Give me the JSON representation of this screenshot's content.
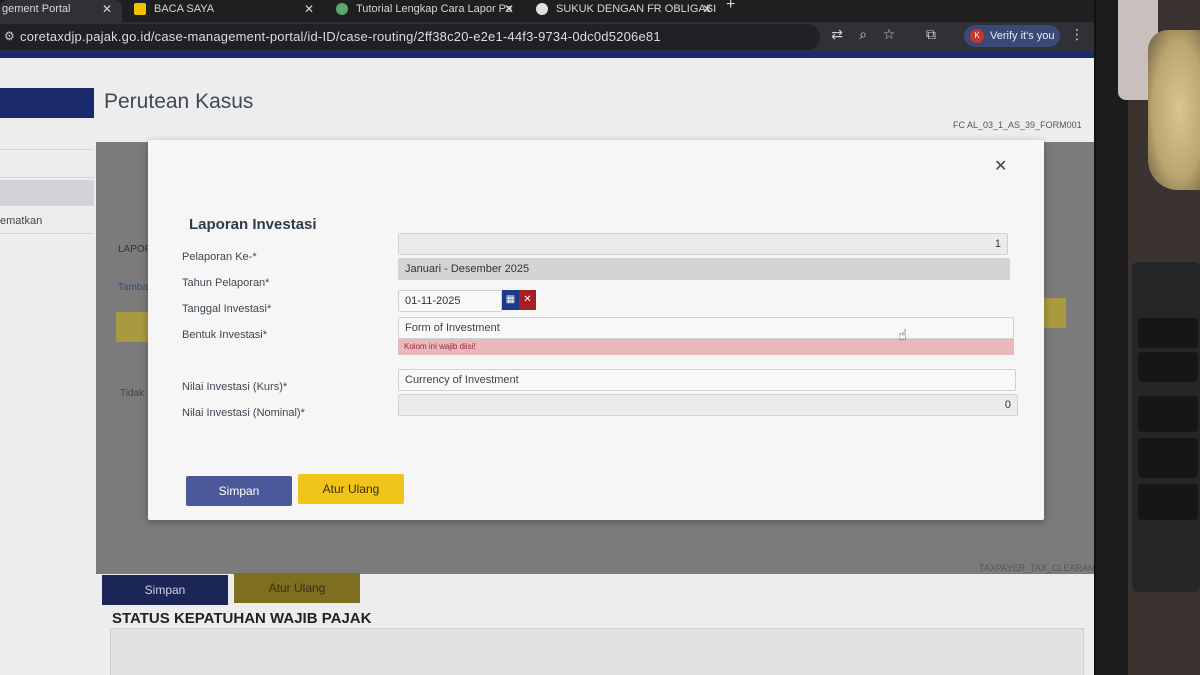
{
  "browser": {
    "tabs": [
      {
        "label": "gement Portal",
        "active": true
      },
      {
        "label": "BACA SAYA",
        "active": false
      },
      {
        "label": "Tutorial Lengkap Cara Lapor Pa",
        "active": false
      },
      {
        "label": "SUKUK DENGAN FR OBLIGASI",
        "active": false
      }
    ],
    "url": "coretaxdjp.pajak.go.id/case-management-portal/id-ID/case-routing/2ff38c20-e2e1-44f3-9734-0dc0d5206e81",
    "profile_initial": "K",
    "verify_label": "Verify it's you"
  },
  "page": {
    "title": "Perutean Kasus",
    "form_code_top": "FC AL_03_1_AS_39_FORM001",
    "form_code_bottom": "TAXPAYER_TAX_CLEARANCE",
    "sidebar_item": "ematkan",
    "bg_lapor": "LAPOF",
    "bg_tamba": "Tamba",
    "bg_tidak": "Tidak",
    "bg_save_label": "Simpan",
    "bg_reset_label": "Atur Ulang",
    "status_title": "STATUS KEPATUHAN WAJIB PAJAK"
  },
  "modal": {
    "title": "Laporan Investasi",
    "fields": {
      "pelaporan_label": "Pelaporan Ke-*",
      "pelaporan_value": "1",
      "tahun_label": "Tahun Pelaporan*",
      "tahun_value": "Januari - Desember 2025",
      "tanggal_label": "Tanggal Investasi*",
      "tanggal_value": "01-11-2025",
      "bentuk_label": "Bentuk Investasi*",
      "bentuk_placeholder": "Form of Investment",
      "bentuk_error": "Kolom ini wajib diisi!",
      "kurs_label": "Nilai Investasi (Kurs)*",
      "kurs_placeholder": "Currency of Investment",
      "nominal_label": "Nilai Investasi (Nominal)*",
      "nominal_value": "0"
    },
    "save_label": "Simpan",
    "reset_label": "Atur Ulang"
  },
  "colors": {
    "primary": "#1a2a6c",
    "save_button": "#4b5899",
    "reset_button": "#f0c419",
    "error_bg": "#e8b8bb",
    "clear_button": "#a51f24"
  }
}
